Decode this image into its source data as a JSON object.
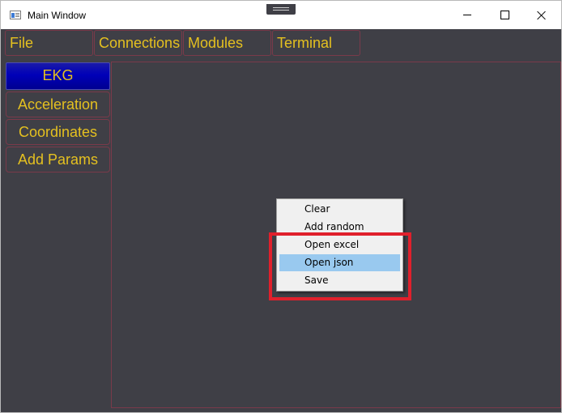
{
  "window": {
    "title": "Main Window",
    "minimize_label": "",
    "maximize_label": "",
    "close_label": ""
  },
  "menubar": {
    "items": [
      {
        "label": "File"
      },
      {
        "label": "Connections"
      },
      {
        "label": "Modules"
      },
      {
        "label": "Terminal"
      }
    ]
  },
  "sidebar": {
    "items": [
      {
        "label": "EKG",
        "active": true
      },
      {
        "label": "Acceleration",
        "active": false
      },
      {
        "label": "Coordinates",
        "active": false
      },
      {
        "label": "Add Params",
        "active": false
      }
    ]
  },
  "context_menu": {
    "items": [
      {
        "label": "Clear",
        "highlighted": false
      },
      {
        "label": "Add random",
        "highlighted": false
      },
      {
        "label": "Open excel",
        "highlighted": false
      },
      {
        "label": "Open json",
        "highlighted": true
      },
      {
        "label": "Save",
        "highlighted": false
      }
    ]
  },
  "colors": {
    "background": "#3f3f46",
    "accent_text": "#e4c020",
    "active_tab": "#0000b8",
    "menu_hover": "#99c9ef",
    "annotation": "#e0202c"
  },
  "icons": [
    "app-window-icon",
    "minimize-icon",
    "maximize-icon",
    "close-icon",
    "drag-grip-icon"
  ]
}
